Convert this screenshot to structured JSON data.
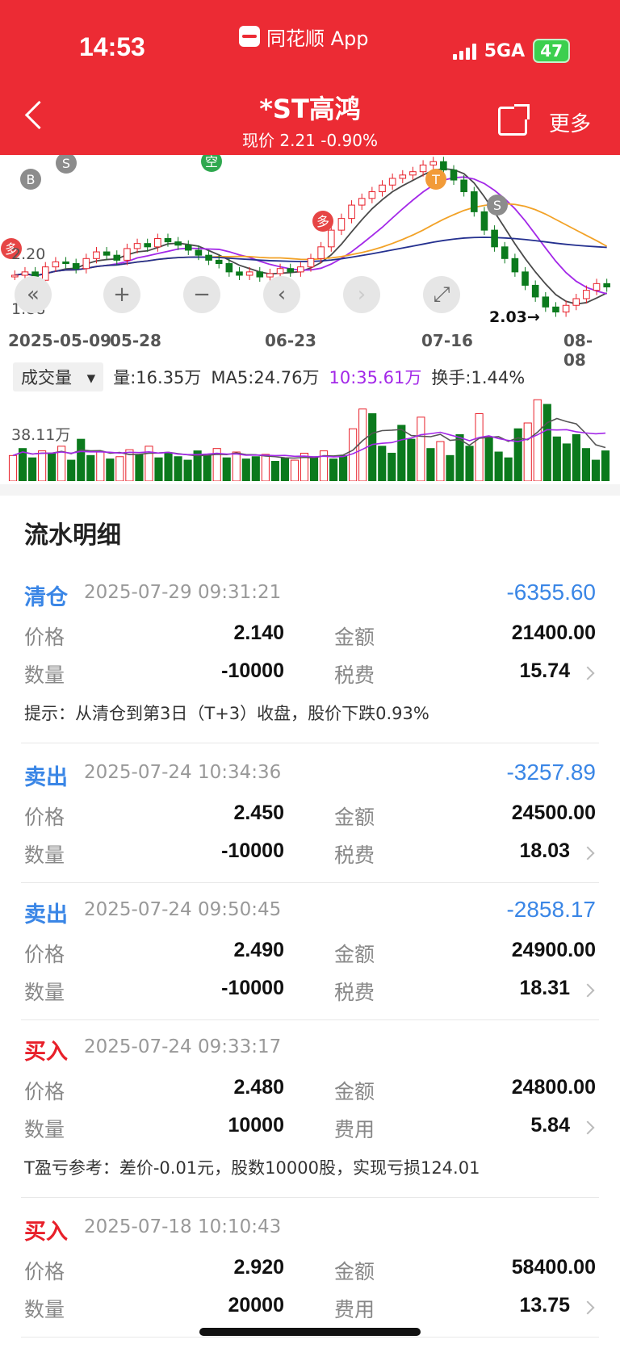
{
  "status_bar": {
    "time": "14:53",
    "app_badge": "同花顺 App",
    "network": "5GA",
    "battery": "47"
  },
  "nav": {
    "back_icon": "chevron-left-icon",
    "title": "*ST高鸿",
    "subtitle": "现价 2.21 -0.90%",
    "share_icon": "share-icon",
    "more_label": "更多"
  },
  "kline": {
    "price_labels": [
      "2.20",
      "1.88"
    ],
    "low_marker": "2.03→",
    "controls": [
      "«",
      "+",
      "−",
      "‹",
      "›",
      "⤢"
    ],
    "dates": [
      "2025-05-09",
      "05-28",
      "06-23",
      "07-16",
      "08-08"
    ],
    "markers": [
      {
        "text": "B",
        "color": "#8c8c8c"
      },
      {
        "text": "S",
        "color": "#8c8c8c"
      },
      {
        "text": "空",
        "color": "#2fa84f"
      },
      {
        "text": "多",
        "color": "#e64545"
      },
      {
        "text": "T",
        "color": "#f29b38"
      },
      {
        "text": "S",
        "color": "#8c8c8c"
      },
      {
        "text": "多",
        "color": "#e64545"
      }
    ],
    "price_candles": [
      2.28,
      2.3,
      2.25,
      2.33,
      2.36,
      2.35,
      2.32,
      2.38,
      2.42,
      2.4,
      2.37,
      2.44,
      2.47,
      2.45,
      2.5,
      2.48,
      2.46,
      2.43,
      2.4,
      2.37,
      2.35,
      2.3,
      2.28,
      2.3,
      2.27,
      2.29,
      2.32,
      2.3,
      2.33,
      2.38,
      2.45,
      2.55,
      2.62,
      2.7,
      2.74,
      2.78,
      2.82,
      2.86,
      2.88,
      2.9,
      2.94,
      2.96,
      2.91,
      2.85,
      2.78,
      2.66,
      2.55,
      2.45,
      2.38,
      2.3,
      2.22,
      2.15,
      2.09,
      2.06,
      2.1,
      2.14,
      2.19,
      2.23,
      2.21
    ]
  },
  "volume": {
    "selector": "成交量",
    "vol": "量:16.35万",
    "ma5": "MA5:24.76万",
    "ma10": "10:35.61万",
    "turnover": "换手:1.44%",
    "axis_label": "38.11万",
    "bars": [
      22,
      28,
      20,
      26,
      24,
      30,
      18,
      36,
      22,
      25,
      19,
      21,
      27,
      23,
      30,
      20,
      24,
      21,
      18,
      26,
      22,
      28,
      20,
      25,
      19,
      21,
      23,
      17,
      20,
      18,
      24,
      21,
      26,
      19,
      22,
      45,
      62,
      58,
      30,
      24,
      48,
      36,
      55,
      28,
      34,
      22,
      40,
      30,
      58,
      38,
      25,
      20,
      45,
      50,
      70,
      66,
      38,
      32,
      40,
      28,
      18,
      26
    ]
  },
  "ledger": {
    "title": "流水明细",
    "entries": [
      {
        "type": "清仓",
        "time": "2025-07-29 09:31:21",
        "amount": "-6355.60",
        "price_label": "价格",
        "price": "2.140",
        "value_label": "金额",
        "value": "21400.00",
        "qty_label": "数量",
        "qty": "-10000",
        "fee_label": "税费",
        "fee": "15.74",
        "tip": "提示：从清仓到第3日（T+3）收盘，股价下跌0.93%"
      },
      {
        "type": "卖出",
        "time": "2025-07-24 10:34:36",
        "amount": "-3257.89",
        "price_label": "价格",
        "price": "2.450",
        "value_label": "金额",
        "value": "24500.00",
        "qty_label": "数量",
        "qty": "-10000",
        "fee_label": "税费",
        "fee": "18.03",
        "tip": ""
      },
      {
        "type": "卖出",
        "time": "2025-07-24 09:50:45",
        "amount": "-2858.17",
        "price_label": "价格",
        "price": "2.490",
        "value_label": "金额",
        "value": "24900.00",
        "qty_label": "数量",
        "qty": "-10000",
        "fee_label": "税费",
        "fee": "18.31",
        "tip": ""
      },
      {
        "type": "买入",
        "time": "2025-07-24 09:33:17",
        "amount": "",
        "price_label": "价格",
        "price": "2.480",
        "value_label": "金额",
        "value": "24800.00",
        "qty_label": "数量",
        "qty": "10000",
        "fee_label": "费用",
        "fee": "5.84",
        "tip": "T盈亏参考：差价-0.01元，股数10000股，实现亏损124.01"
      },
      {
        "type": "买入",
        "time": "2025-07-18 10:10:43",
        "amount": "",
        "price_label": "价格",
        "price": "2.920",
        "value_label": "金额",
        "value": "58400.00",
        "qty_label": "数量",
        "qty": "20000",
        "fee_label": "费用",
        "fee": "13.75",
        "tip": ""
      }
    ]
  },
  "colors": {
    "header": "#ec2b34",
    "up": "#e8202a",
    "down": "#0b7a1d",
    "sell": "#3a86e6"
  }
}
